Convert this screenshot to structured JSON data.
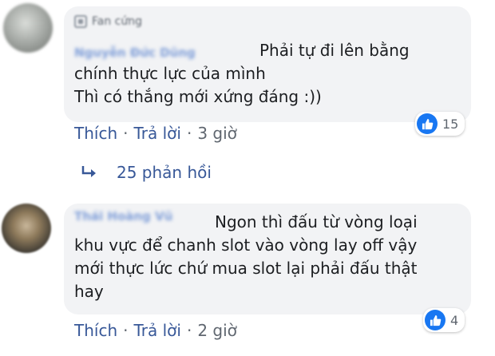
{
  "comments": [
    {
      "badge": "Fan cứng",
      "author": "Nguyễn Đức Dũng",
      "text": "Phải tự đi lên bằng\nchính thực lực của mình\nThì có thắng mới xứng đáng :))",
      "actions": {
        "like": "Thích",
        "reply": "Trả lời",
        "time": "3 giờ"
      },
      "reaction_count": "15"
    },
    {
      "author": "Thái Hoàng Vũ",
      "text": "Ngon thì đấu từ vòng loại\nkhu vực để chanh slot vào vòng lay off vậy\nmới thực lức chứ mua slot lại phải đấu thật\nhay",
      "actions": {
        "like": "Thích",
        "reply": "Trả lời",
        "time": "2 giờ"
      },
      "reaction_count": "4"
    }
  ],
  "replies": {
    "label": "25 phản hồi"
  },
  "icons": {
    "like": "like-thumb-icon",
    "reply": "reply-arrow-icon",
    "badge": "fan-badge-icon"
  },
  "colors": {
    "link": "#385898",
    "bubble": "#f2f3f5",
    "like_blue": "#1877f2"
  }
}
